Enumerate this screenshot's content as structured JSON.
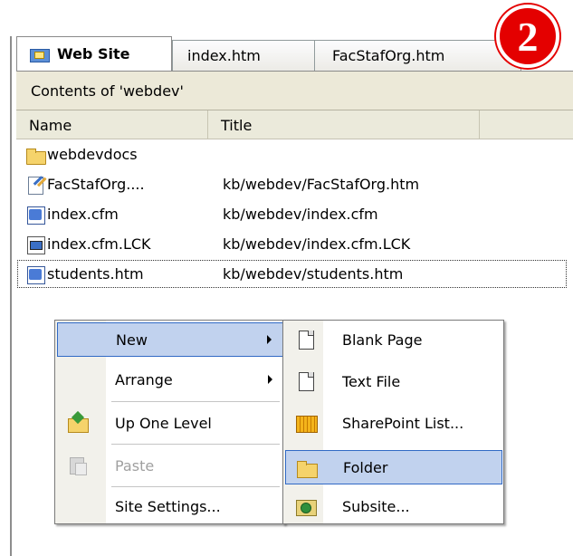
{
  "badge": "2",
  "tabs": [
    {
      "label": "Web Site",
      "icon": "folder-icon"
    },
    {
      "label": "index.htm"
    },
    {
      "label": "FacStafOrg.htm"
    }
  ],
  "contents_label": "Contents of 'webdev'",
  "columns": {
    "name": "Name",
    "title": "Title"
  },
  "files": [
    {
      "name": "webdevdocs",
      "title": "",
      "icon": "folder-icon"
    },
    {
      "name": "FacStafOrg....",
      "title": "kb/webdev/FacStafOrg.htm",
      "icon": "htm-edit-icon"
    },
    {
      "name": "index.cfm",
      "title": "kb/webdev/index.cfm",
      "icon": "cfm-page-icon"
    },
    {
      "name": "index.cfm.LCK",
      "title": "kb/webdev/index.cfm.LCK",
      "icon": "lck-file-icon"
    },
    {
      "name": "students.htm",
      "title": "kb/webdev/students.htm",
      "icon": "htm-page-icon"
    }
  ],
  "context_menu": [
    {
      "label": "New",
      "submenu": true,
      "highlighted": true
    },
    {
      "label": "Arrange",
      "submenu": true
    },
    {
      "label": "Up One Level",
      "icon": "up-folder-icon"
    },
    {
      "label": "Paste",
      "icon": "paste-icon",
      "disabled": true
    },
    {
      "label": "Site Settings..."
    }
  ],
  "new_submenu": [
    {
      "label": "Blank Page",
      "icon": "blank-page-icon"
    },
    {
      "label": "Text File",
      "icon": "text-file-icon"
    },
    {
      "label": "SharePoint List...",
      "icon": "sharepoint-list-icon"
    },
    {
      "label": "Folder",
      "icon": "folder-icon",
      "highlighted": true
    },
    {
      "label": "Subsite...",
      "icon": "subsite-icon"
    }
  ],
  "colors": {
    "highlight": "#c1d2ee",
    "highlight_border": "#316ac5",
    "badge": "#e40000"
  }
}
